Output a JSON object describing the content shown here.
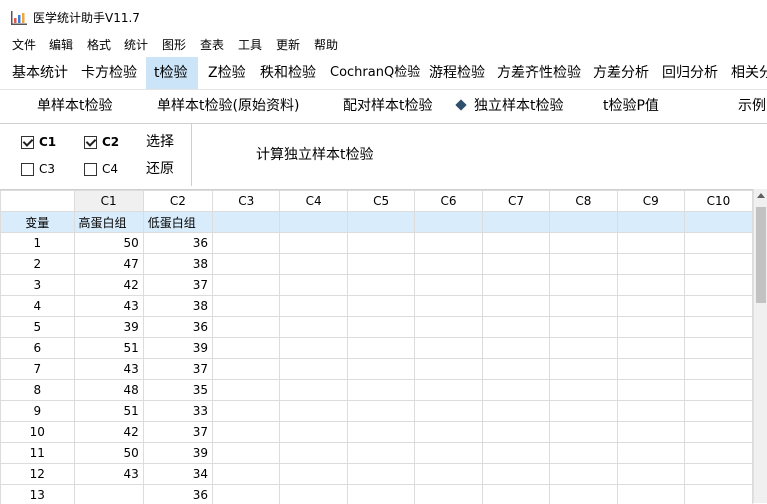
{
  "window": {
    "title": "医学统计助手V11.7"
  },
  "menu": [
    "文件",
    "编辑",
    "格式",
    "统计",
    "图形",
    "查表",
    "工具",
    "更新",
    "帮助"
  ],
  "tabs": [
    "基本统计",
    "卡方检验",
    "t检验",
    "Z检验",
    "秩和检验",
    "CochranQ检验",
    "游程检验",
    "方差齐性检验",
    "方差分析",
    "回归分析",
    "相关分"
  ],
  "active_tab": "t检验",
  "subtabs": [
    "单样本t检验",
    "单样本t检验(原始资料)",
    "配对样本t检验",
    "独立样本t检验",
    "t检验P值",
    "示例"
  ],
  "active_subtab": "独立样本t检验",
  "options": {
    "c1": {
      "label": "C1",
      "checked": true
    },
    "c2": {
      "label": "C2",
      "checked": true
    },
    "c3": {
      "label": "C3",
      "checked": false
    },
    "c4": {
      "label": "C4",
      "checked": false
    },
    "select_label": "选择",
    "restore_label": "还原",
    "calc_label": "计算独立样本t检验"
  },
  "grid": {
    "columns": [
      "C1",
      "C2",
      "C3",
      "C4",
      "C5",
      "C6",
      "C7",
      "C8",
      "C9",
      "C10"
    ],
    "var_label": "变量",
    "var_names": [
      "高蛋白组",
      "低蛋白组"
    ],
    "rows": [
      {
        "n": "1",
        "c1": "50",
        "c2": "36"
      },
      {
        "n": "2",
        "c1": "47",
        "c2": "38"
      },
      {
        "n": "3",
        "c1": "42",
        "c2": "37"
      },
      {
        "n": "4",
        "c1": "43",
        "c2": "38"
      },
      {
        "n": "5",
        "c1": "39",
        "c2": "36"
      },
      {
        "n": "6",
        "c1": "51",
        "c2": "39"
      },
      {
        "n": "7",
        "c1": "43",
        "c2": "37"
      },
      {
        "n": "8",
        "c1": "48",
        "c2": "35"
      },
      {
        "n": "9",
        "c1": "51",
        "c2": "33"
      },
      {
        "n": "10",
        "c1": "42",
        "c2": "37"
      },
      {
        "n": "11",
        "c1": "50",
        "c2": "39"
      },
      {
        "n": "12",
        "c1": "43",
        "c2": "34"
      },
      {
        "n": "13",
        "c1": "",
        "c2": "36"
      }
    ]
  },
  "colors": {
    "active_tab_bg": "#cce4f7",
    "var_row_bg": "#d9ecfb"
  }
}
